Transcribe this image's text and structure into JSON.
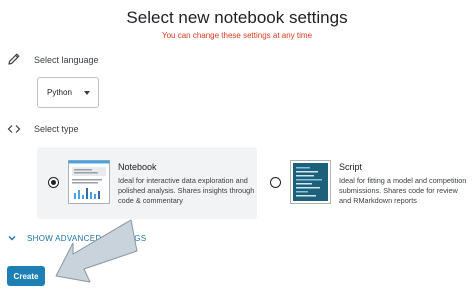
{
  "header": {
    "title": "Select new notebook settings",
    "subtitle": "You can change these settings at any time"
  },
  "language": {
    "label": "Select language",
    "selected": "Python",
    "icon": "pencil-icon"
  },
  "type": {
    "label": "Select type",
    "icon": "code-brackets-icon",
    "options": [
      {
        "title": "Notebook",
        "description": "Ideal for interactive data exploration and polished analysis. Shares insights through code & commentary",
        "selected": true
      },
      {
        "title": "Script",
        "description": "Ideal for fitting a model and competition submissions. Shares code for review and RMarkdown reports",
        "selected": false
      }
    ]
  },
  "advanced": {
    "label": "SHOW ADVANCED SETTINGS",
    "icon": "chevron-down-icon"
  },
  "actions": {
    "create_label": "Create"
  },
  "colors": {
    "subtitle": "#d73a1d",
    "accent": "#1a73a8",
    "button": "#1e7fb5",
    "arrow_fill": "#c9d3dc"
  }
}
